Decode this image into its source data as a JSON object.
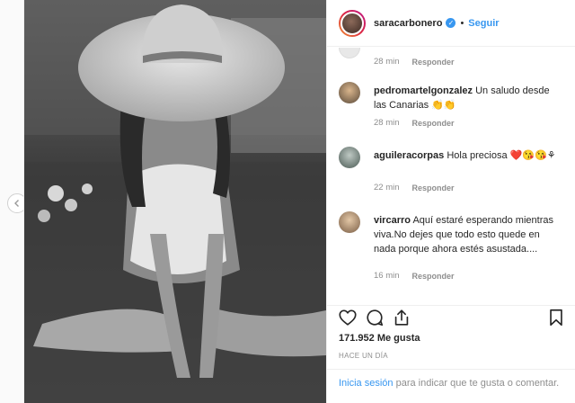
{
  "header": {
    "username": "saracarbonero",
    "verified_mark": "✓",
    "separator": "•",
    "follow_label": "Seguir"
  },
  "comments": {
    "first": {
      "time": "28 min",
      "reply": "Responder"
    },
    "items": [
      {
        "username": "pedromartelgonzalez",
        "text": "Un saludo desde las Canarias 👏👏",
        "time": "28 min",
        "reply": "Responder"
      },
      {
        "username": "aguileracorpas",
        "text": "Hola preciosa ❤️😘😘⚘",
        "time": "22 min",
        "reply": "Responder"
      },
      {
        "username": "vircarro",
        "text": "Aquí estaré esperando mientras viva.No dejes que todo esto quede en nada porque ahora estés asustada....",
        "time": "16 min",
        "reply": "Responder"
      }
    ]
  },
  "actions": {
    "icons": [
      "heart-icon",
      "comment-icon",
      "share-icon",
      "bookmark-icon"
    ],
    "likes": "171.952 Me gusta",
    "date": "HACE UN DÍA"
  },
  "login_prompt": {
    "link": "Inicia sesión",
    "text": " para indicar que te gusta o comentar."
  },
  "colors": {
    "accent": "#3897f0",
    "muted": "#8e8e8e",
    "text": "#262626",
    "border": "#efefef"
  }
}
